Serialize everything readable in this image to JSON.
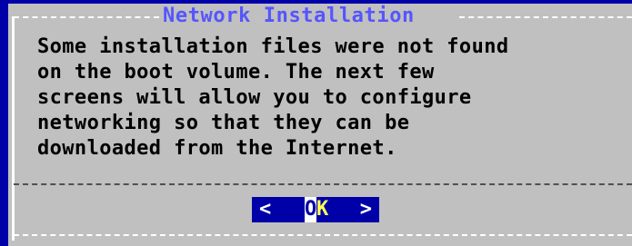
{
  "dialog": {
    "title": "Network Installation",
    "message_lines": [
      "Some installation files were not found",
      "on the boot volume. The next few",
      "screens will allow you to configure",
      "networking so that they can be",
      "downloaded from the Internet."
    ]
  },
  "buttons": {
    "ok": {
      "left_bracket": "<",
      "hotkey": "O",
      "rest": "K",
      "right_bracket": ">"
    }
  },
  "colors": {
    "background": "#0000a8",
    "dialog": "#c0c0c0",
    "title": "#5555ff",
    "button_bg": "#0000a8",
    "button_hotkey_text": "#ffff55"
  }
}
